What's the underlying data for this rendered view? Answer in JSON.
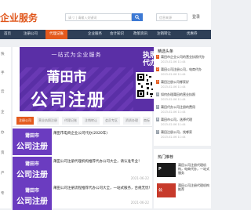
{
  "header": {
    "logo_text": "企业服务",
    "search_placeholder": "请 ▽ | 请输入关键词",
    "site_placeholder": "信息来源",
    "login_text": "登录"
  },
  "nav": {
    "items": [
      "首页",
      "注册公司",
      "代理记账",
      "企业服务",
      "会计知识",
      "政策资讯",
      "注销转让",
      "优惠券"
    ]
  },
  "left_strip": [
    "快",
    "手",
    "云",
    "企",
    "办",
    "资",
    "产",
    "专"
  ],
  "banner": {
    "top_text": "一站式为企业服务",
    "city": "莆田市",
    "big_text": "公司注册",
    "agent_text": "执照代办"
  },
  "tabs": [
    "注册公司",
    "营业执照注册",
    "代理记账",
    "注销转让",
    "会员专区",
    "资质办理",
    "商标"
  ],
  "articles": [
    {
      "thumb_top": "莆田市",
      "thumb_main": "公司注册",
      "title": "莆田市电商企业公司代办(2020年)",
      "meta": "",
      "date": ""
    },
    {
      "thumb_top": "莆田市",
      "thumb_main": "公司注册",
      "title": "莆田公司注册代理机构推荐代办公司大全，请认准专业！",
      "meta": "",
      "date": "2021-06-22"
    },
    {
      "thumb_top": "莆田市",
      "thumb_main": "公司注册",
      "title": "莆田公司注册流程推荐代办公司大全，一站式服务，合规无忧！",
      "meta": "",
      "date": "2021-06-22"
    }
  ],
  "sidebar": {
    "title": "精选头条",
    "items": [
      {
        "text": "莆田市企业公司的营业执照代办",
        "date": "2023-02-06 11:44"
      },
      {
        "text": "莆田公司注册公司，电商代办",
        "date": "2023-02-06 11:44"
      },
      {
        "text": "莆田注册公司哪家好",
        "date": "2023-02-06 11:44"
      },
      {
        "text": "如何办理莆田的营业执照",
        "date": "2023-02-06 11:44"
      },
      {
        "text": "莆田代办公司注册的费用",
        "date": "2023-02-06 11:44"
      },
      {
        "text": "莆田市公司，选择代理",
        "date": "2023-02-06 11:44"
      },
      {
        "text": "莆田注册公司，找哪家",
        "date": "2023-02-06 11:44"
      }
    ]
  },
  "hot": {
    "title": "热门推荐",
    "items": [
      {
        "logo": "P",
        "text": "莆田公司注册代理机构，电商代办，一站式服务"
      },
      {
        "logo": "公",
        "text": "莆田公司注册代理机构推荐"
      }
    ]
  },
  "colors": {
    "accent": "#e45a1d",
    "nav": "#2e3f57",
    "banner": "#5a2fa6",
    "primary_btn": "#3c79d4"
  }
}
